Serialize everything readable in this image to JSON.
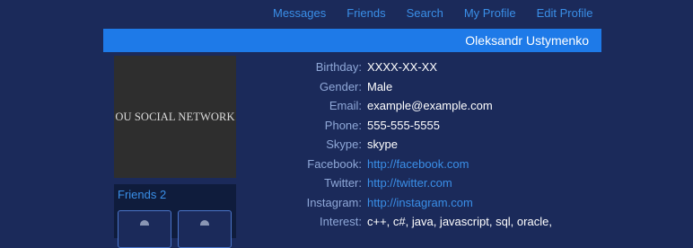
{
  "nav": {
    "messages": "Messages",
    "friends": "Friends",
    "search": "Search",
    "my_profile": "My Profile",
    "edit_profile": "Edit Profile"
  },
  "profile": {
    "name": "Oleksandr Ustymenko",
    "avatar_text": "OU SOCIAL NETWORK"
  },
  "friends_panel": {
    "title": "Friends 2"
  },
  "details": {
    "birthday": {
      "label": "Birthday:",
      "value": "XXXX-XX-XX"
    },
    "gender": {
      "label": "Gender:",
      "value": "Male"
    },
    "email": {
      "label": "Email:",
      "value": "example@example.com"
    },
    "phone": {
      "label": "Phone:",
      "value": "555-555-5555"
    },
    "skype": {
      "label": "Skype:",
      "value": "skype"
    },
    "facebook": {
      "label": "Facebook:",
      "value": "http://facebook.com"
    },
    "twitter": {
      "label": "Twitter:",
      "value": "http://twitter.com"
    },
    "instagram": {
      "label": "Instagram:",
      "value": "http://instagram.com"
    },
    "interest": {
      "label": "Interest:",
      "value": "c++, c#, java, javascript, sql, oracle,"
    }
  },
  "colors": {
    "background": "#1b2a5a",
    "accent": "#1e7ae8",
    "link": "#3a8fe8",
    "label": "#8fa8d8"
  }
}
